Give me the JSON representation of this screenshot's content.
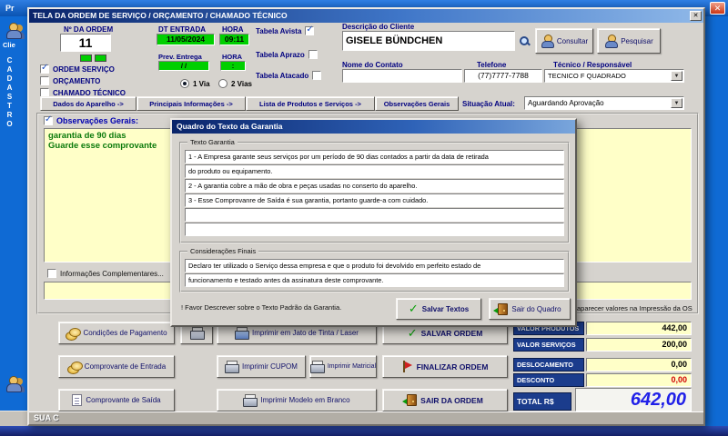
{
  "icons": {
    "close": "✕",
    "check": "✓",
    "dropdown": "▼"
  },
  "screen": {
    "outer_title": "Pr",
    "left_rail": {
      "client_label": "Clie",
      "vertical_word": "CADASTRO"
    }
  },
  "window": {
    "title": "TELA DA ORDEM DE SERVIÇO / ORÇAMENTO / CHAMADO TÉCNICO",
    "status_text": "SUA C"
  },
  "order": {
    "number_label": "Nº DA ORDEM",
    "number": "11",
    "date_label": "DT ENTRADA",
    "date": "11/05/2024",
    "time_label": "HORA",
    "time": "09:11",
    "prev_label": "Prev. Entrega",
    "prev_date": "/  /",
    "prev_time_label": "HORA",
    "prev_time": ":",
    "types": [
      {
        "label": "ORDEM SERVIÇO",
        "checked": true
      },
      {
        "label": "ORÇAMENTO",
        "checked": false
      },
      {
        "label": "CHAMADO TÉCNICO",
        "checked": false
      }
    ],
    "vias": [
      {
        "label": "1 Via",
        "selected": true
      },
      {
        "label": "2 Vias",
        "selected": false
      }
    ],
    "price_tables": [
      {
        "label": "Tabela Avista",
        "checked": true
      },
      {
        "label": "Tabela Aprazo",
        "checked": false
      },
      {
        "label": "Tabela Atacado",
        "checked": false
      }
    ]
  },
  "client": {
    "label": "Descrição do Cliente",
    "name": "GISELE BÜNDCHEN",
    "consultar": "Consultar",
    "pesquisar": "Pesquisar",
    "contact_label": "Nome do Contato",
    "contact": "",
    "phone_label": "Telefone",
    "phone": "(77)7777-7788",
    "tech_label": "Técnico / Responsável",
    "tech": "TECNICO F QUADRADO"
  },
  "tabs": [
    {
      "label": "Dados do Aparelho ->"
    },
    {
      "label": "Principais Informações ->"
    },
    {
      "label": "Lista de Produtos e Serviços ->"
    },
    {
      "label": "Observações Gerais"
    }
  ],
  "situacao": {
    "label": "Situação Atual:",
    "value": "Aguardando Aprovação"
  },
  "obs": {
    "label": "Observações Gerais:",
    "line1": "garantia de 90 dias",
    "line2": "Guarde esse comprovante",
    "complementares": "Informações Complementares..."
  },
  "modal": {
    "title": "Quadro do Texto da Garantia",
    "texto_label": "Texto Garantia",
    "texto_lines": [
      "1 - A Empresa garante seus serviços por um período de 90 dias contados a partir da data de retirada",
      "do produto ou equipamento.",
      "2 - A garantia cobre a mão de obra e peças usadas no conserto do aparelho.",
      "3 - Esse Comprovanre de Saída é sua garantia, portanto guarde-a com cuidado.",
      "",
      ""
    ],
    "consid_label": "Considerações Finais",
    "consid_lines": [
      "Declaro ter utilizado o Serviço dessa empresa e que o produto foi devolvido em perfeito estado de",
      "funcionamento e testado antes da assinatura deste comprovante."
    ],
    "hint": "! Favor Descrever sobre o Texto Padrão da Garantia.",
    "save": "Salvar Textos",
    "exit": "Sair do Quadro"
  },
  "actions": {
    "cond_pag": "Condições de Pagamento",
    "jato": "Imprimir em Jato de Tinta / Laser",
    "salvar": "SALVAR ORDEM",
    "comp_entrada": "Comprovante de Entrada",
    "cupom": "Imprimir CUPOM",
    "matricial": "Imprimir Matricial",
    "finalizar": "FINALIZAR ORDEM",
    "comp_saida": "Comprovante de Saída",
    "modelo": "Imprimir Modelo em Branco",
    "sair": "SAIR DA ORDEM"
  },
  "totals": {
    "note": "aparecer valores na Impressão da OS",
    "rows": [
      {
        "label": "VALOR PRODUTOS",
        "value": "442,00"
      },
      {
        "label": "VALOR SERVIÇOS",
        "value": "200,00"
      },
      {
        "label": "DESLOCAMENTO",
        "value": "0,00"
      },
      {
        "label": "DESCONTO",
        "value": "0,00"
      }
    ],
    "total_label": "TOTAL R$",
    "total": "642,00"
  },
  "colors": {
    "desktop": "#0f6ad4",
    "green_field": "#00cf00",
    "yellow_area": "#ffffc8",
    "label_navy": "#000080",
    "total_blue": "#2020e8",
    "desconto_red": "#d00000"
  }
}
